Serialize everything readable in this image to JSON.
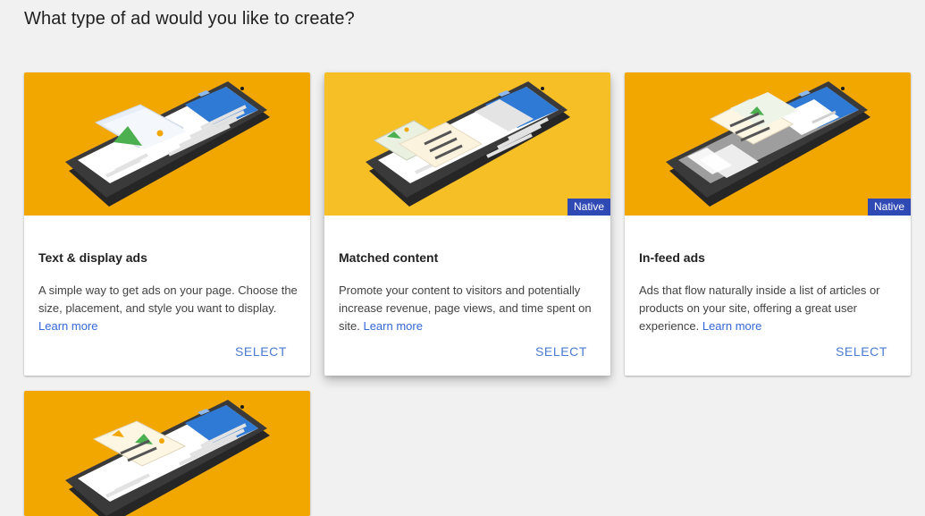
{
  "page": {
    "title": "What type of ad would you like to create?"
  },
  "colors": {
    "background": "#f1f1f1",
    "hero_orange": "#f2a600",
    "hero_yellow": "#f6bf26",
    "badge_blue": "#2f4ab5",
    "link_blue": "#3367d6"
  },
  "cards": [
    {
      "title": "Text & display ads",
      "description": "A simple way to get ads on your page. Choose the size, placement, and style you want to display.",
      "learn_more": "Learn more",
      "select": "SELECT",
      "badge": "",
      "illustration": "phone-display-ad-icon"
    },
    {
      "title": "Matched content",
      "description": "Promote your content to visitors and potentially increase revenue, page views, and time spent on site.",
      "learn_more": "Learn more",
      "select": "SELECT",
      "badge": "Native",
      "illustration": "phone-matched-content-icon"
    },
    {
      "title": "In-feed ads",
      "description": "Ads that flow naturally inside a list of articles or products on your site, offering a great user experience.",
      "learn_more": "Learn more",
      "select": "SELECT",
      "badge": "Native",
      "illustration": "phone-in-feed-icon"
    },
    {
      "title": "",
      "description": "",
      "learn_more": "",
      "select": "",
      "badge": "",
      "illustration": "phone-in-article-icon"
    }
  ]
}
